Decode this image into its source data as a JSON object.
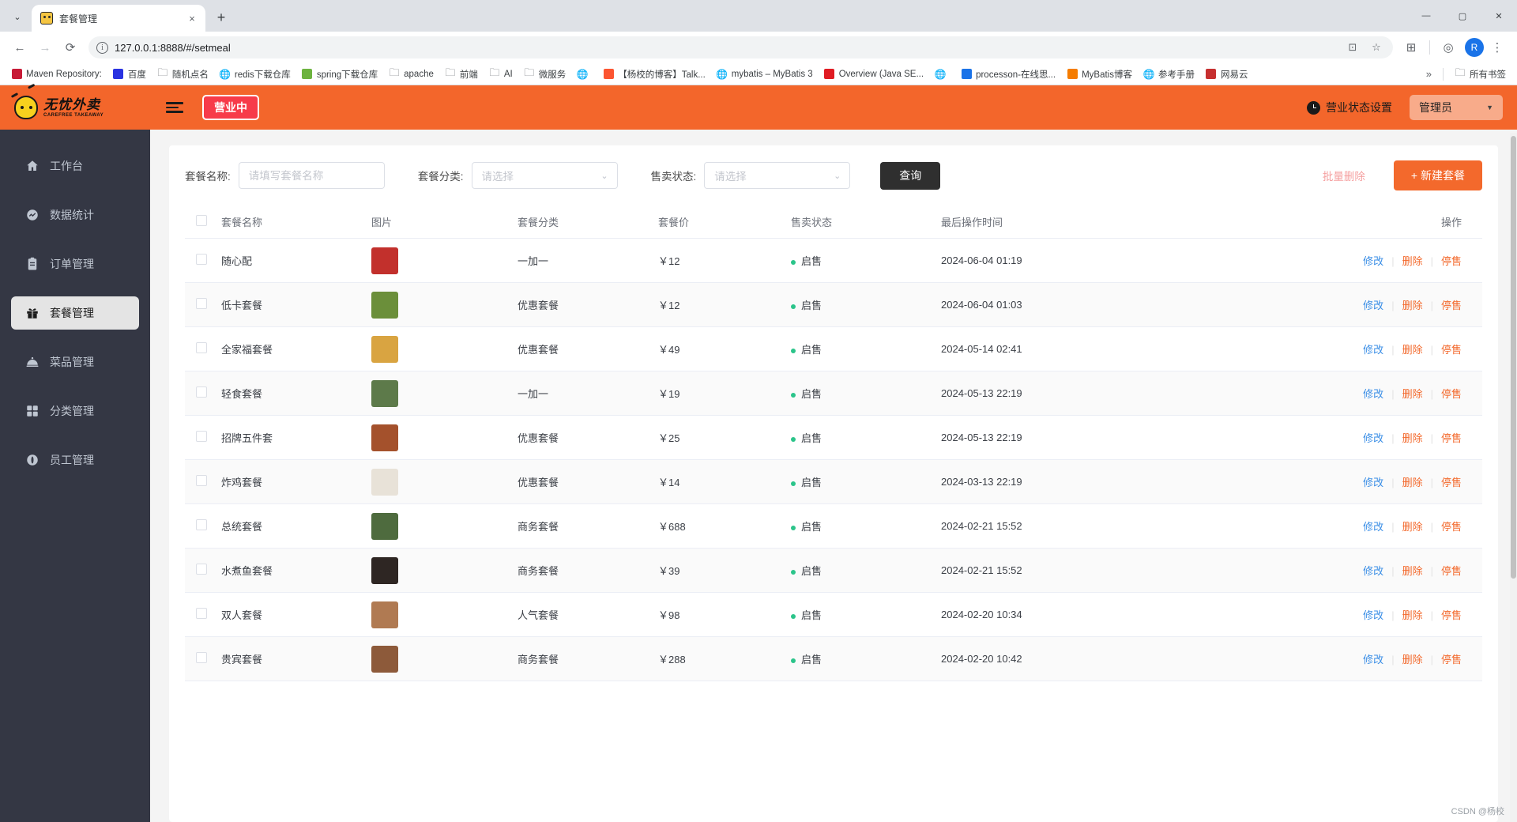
{
  "browser": {
    "tab": {
      "title": "套餐管理",
      "favicon": "app-favicon",
      "close_label": "×"
    },
    "new_tab_label": "+",
    "tab_list_chevron": "⌄",
    "window_controls": {
      "minimize": "—",
      "maximize": "▢",
      "close": "✕"
    },
    "nav": {
      "back": "←",
      "forward": "→",
      "reload": "⟳"
    },
    "omnibox": {
      "info_glyph": "i",
      "url": "127.0.0.1:8888/#/setmeal",
      "cast_icon": "⊡",
      "star_icon": "☆"
    },
    "toolbar_right": {
      "extensions_icon": "⊞",
      "menu_icon": "⋮",
      "profile_icon": "◎",
      "avatar_initial": "R"
    },
    "bookmarks": [
      {
        "label": "Maven Repository:",
        "icon": "mvn-icon",
        "icon_type": "square",
        "color": "#c71a36"
      },
      {
        "label": "百度",
        "icon": "baidu-icon",
        "icon_type": "square",
        "color": "#2932e1"
      },
      {
        "label": "随机点名",
        "icon": "folder-icon",
        "icon_type": "folder"
      },
      {
        "label": "redis下载仓库",
        "icon": "globe-icon",
        "icon_type": "globe"
      },
      {
        "label": "spring下载仓库",
        "icon": "frog-icon",
        "icon_type": "square",
        "color": "#6db33f"
      },
      {
        "label": "apache",
        "icon": "folder-icon",
        "icon_type": "folder"
      },
      {
        "label": "前端",
        "icon": "folder-icon",
        "icon_type": "folder"
      },
      {
        "label": "AI",
        "icon": "folder-icon",
        "icon_type": "folder"
      },
      {
        "label": "微服务",
        "icon": "folder-icon",
        "icon_type": "folder"
      },
      {
        "label": "",
        "icon": "globe-icon",
        "icon_type": "globe"
      },
      {
        "label": "【杨校的博客】Talk...",
        "icon": "csdn-icon",
        "icon_type": "square",
        "color": "#fc5531"
      },
      {
        "label": "mybatis – MyBatis 3",
        "icon": "globe-icon",
        "icon_type": "globe"
      },
      {
        "label": "Overview (Java SE...",
        "icon": "oracle-icon",
        "icon_type": "square",
        "color": "#e01b22"
      },
      {
        "label": "",
        "icon": "globe-icon",
        "icon_type": "globe"
      },
      {
        "label": "processon-在线思...",
        "icon": "processon-icon",
        "icon_type": "square",
        "color": "#1a73e8"
      },
      {
        "label": "MyBatis博客",
        "icon": "blogger-icon",
        "icon_type": "square",
        "color": "#f57c00"
      },
      {
        "label": "参考手册",
        "icon": "globe-icon",
        "icon_type": "globe"
      },
      {
        "label": "网易云",
        "icon": "netease-icon",
        "icon_type": "square",
        "color": "#c62f2f"
      }
    ],
    "bookmarks_overflow": "»",
    "all_bookmarks": {
      "label": "所有书签",
      "icon": "folder-icon"
    }
  },
  "app_header": {
    "logo_cn": "无忧外卖",
    "logo_en": "CAREFREE TAKEAWAY",
    "menu_toggle_icon": "hamburger-icon",
    "business_status_badge": "营业中",
    "status_setting_label": "营业状态设置",
    "status_setting_icon": "clock-icon",
    "user_role": "管理员",
    "user_caret": "▼",
    "accent_color": "#f3662b",
    "badge_color": "#f73b4a"
  },
  "sidebar": {
    "items": [
      {
        "label": "工作台",
        "icon": "home-icon",
        "active": false
      },
      {
        "label": "数据统计",
        "icon": "chart-icon",
        "active": false
      },
      {
        "label": "订单管理",
        "icon": "clipboard-icon",
        "active": false
      },
      {
        "label": "套餐管理",
        "icon": "gift-icon",
        "active": true
      },
      {
        "label": "菜品管理",
        "icon": "dish-icon",
        "active": false
      },
      {
        "label": "分类管理",
        "icon": "grid-icon",
        "active": false
      },
      {
        "label": "员工管理",
        "icon": "user-icon",
        "active": false
      }
    ]
  },
  "filters": {
    "name_label": "套餐名称:",
    "name_placeholder": "请填写套餐名称",
    "name_value": "",
    "category_label": "套餐分类:",
    "category_placeholder": "请选择",
    "category_value": "",
    "status_label": "售卖状态:",
    "status_placeholder": "请选择",
    "status_value": "",
    "query_button": "查询",
    "batch_delete_button": "批量删除",
    "new_setmeal_button": "+ 新建套餐",
    "caret": "⌄"
  },
  "table": {
    "columns": [
      "套餐名称",
      "图片",
      "套餐分类",
      "套餐价",
      "售卖状态",
      "最后操作时间",
      "操作"
    ],
    "ops": {
      "edit": "修改",
      "delete": "删除",
      "stop": "停售",
      "separator": "|"
    },
    "rows": [
      {
        "name": "随心配",
        "category": "一加一",
        "price": "￥12",
        "status": "启售",
        "time": "2024-06-04 01:19",
        "thumb": "#c2302c"
      },
      {
        "name": "低卡套餐",
        "category": "优惠套餐",
        "price": "￥12",
        "status": "启售",
        "time": "2024-06-04 01:03",
        "thumb": "#6b8f3a"
      },
      {
        "name": "全家福套餐",
        "category": "优惠套餐",
        "price": "￥49",
        "status": "启售",
        "time": "2024-05-14 02:41",
        "thumb": "#d9a441"
      },
      {
        "name": "轻食套餐",
        "category": "一加一",
        "price": "￥19",
        "status": "启售",
        "time": "2024-05-13 22:19",
        "thumb": "#5d7a4a"
      },
      {
        "name": "招牌五件套",
        "category": "优惠套餐",
        "price": "￥25",
        "status": "启售",
        "time": "2024-05-13 22:19",
        "thumb": "#a4512c"
      },
      {
        "name": "炸鸡套餐",
        "category": "优惠套餐",
        "price": "￥14",
        "status": "启售",
        "time": "2024-03-13 22:19",
        "thumb": "#e8e2d8"
      },
      {
        "name": "总统套餐",
        "category": "商务套餐",
        "price": "￥688",
        "status": "启售",
        "time": "2024-02-21 15:52",
        "thumb": "#4e6b3e"
      },
      {
        "name": "水煮鱼套餐",
        "category": "商务套餐",
        "price": "￥39",
        "status": "启售",
        "time": "2024-02-21 15:52",
        "thumb": "#2e2623"
      },
      {
        "name": "双人套餐",
        "category": "人气套餐",
        "price": "￥98",
        "status": "启售",
        "time": "2024-02-20 10:34",
        "thumb": "#b07a52"
      },
      {
        "name": "贵宾套餐",
        "category": "商务套餐",
        "price": "￥288",
        "status": "启售",
        "time": "2024-02-20 10:42",
        "thumb": "#8d5a3a"
      }
    ]
  },
  "watermark": "CSDN @杨校"
}
